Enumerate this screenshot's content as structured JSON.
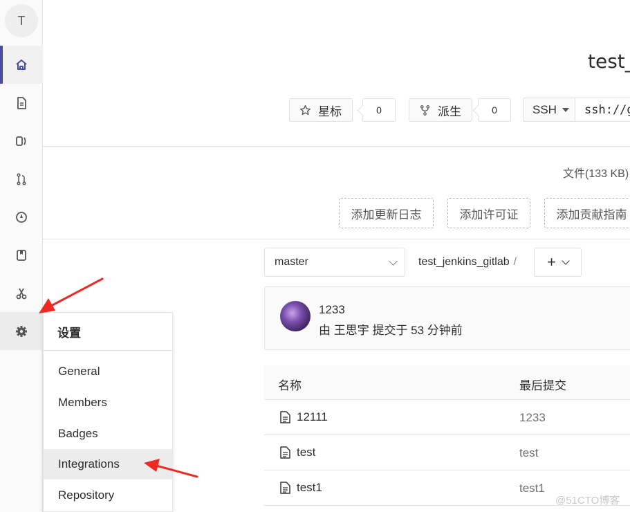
{
  "sidebar": {
    "avatar_letter": "T",
    "items": [
      {
        "icon": "home-icon"
      },
      {
        "icon": "file-icon"
      },
      {
        "icon": "issues-icon"
      },
      {
        "icon": "merge-request-icon"
      },
      {
        "icon": "rocket-icon"
      },
      {
        "icon": "wiki-icon"
      },
      {
        "icon": "snippets-icon"
      },
      {
        "icon": "gear-icon"
      }
    ],
    "active_color": "#4b4ba3"
  },
  "header": {
    "project_title": "test_",
    "star_label": "星标",
    "star_count": "0",
    "fork_label": "派生",
    "fork_count": "0",
    "clone_protocol": "SSH",
    "clone_url": "ssh://g"
  },
  "stats": {
    "files_size": "文件(133 KB)"
  },
  "quick_actions": {
    "add_changelog": "添加更新日志",
    "add_license": "添加许可证",
    "add_contributing": "添加贡献指南"
  },
  "tree": {
    "branch": "master",
    "path_root": "test_jenkins_gitlab",
    "path_sep": "/",
    "add_symbol": "+"
  },
  "last_commit": {
    "title": "1233",
    "meta": "由 王思宇 提交于 53 分钟前"
  },
  "file_table": {
    "headers": {
      "name": "名称",
      "last_commit": "最后提交"
    },
    "rows": [
      {
        "name": "12111",
        "commit": "1233"
      },
      {
        "name": "test",
        "commit": "test"
      },
      {
        "name": "test1",
        "commit": "test1"
      }
    ]
  },
  "settings_flyout": {
    "title": "设置",
    "items": [
      "General",
      "Members",
      "Badges",
      "Integrations",
      "Repository"
    ]
  },
  "watermark": "@51CTO博客",
  "annotation_color": "#ee2a24"
}
